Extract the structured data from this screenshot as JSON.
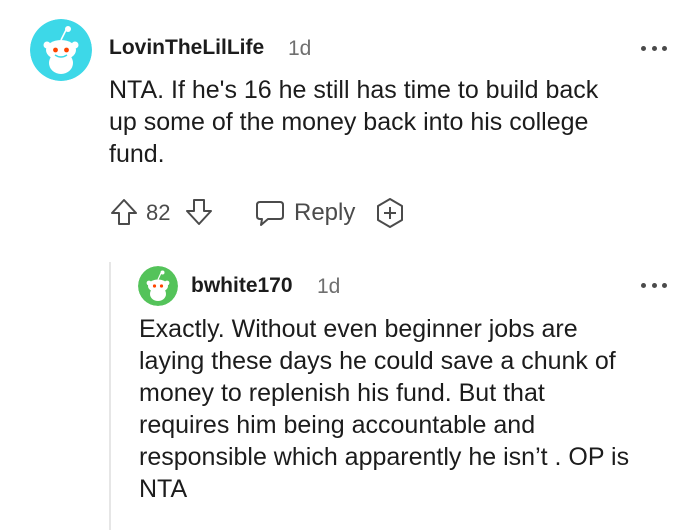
{
  "comment": {
    "username": "LovinTheLilLife",
    "timestamp": "1d",
    "body_lines": [
      "NTA. If he's 16 he still has time to build back",
      "up some of the money back into his college",
      "fund."
    ],
    "vote_count": "82",
    "reply_label": "Reply",
    "avatar_color": "#3dd8e8"
  },
  "reply": {
    "username": "bwhite170",
    "timestamp": "1d",
    "body_lines": [
      "Exactly. Without even beginner jobs are",
      "laying these days he could save a chunk of",
      "money to replenish his fund. But that",
      "requires him being accountable and",
      "responsible which apparently he isn’t . OP is",
      "NTA"
    ],
    "avatar_color": "#54c35a"
  }
}
